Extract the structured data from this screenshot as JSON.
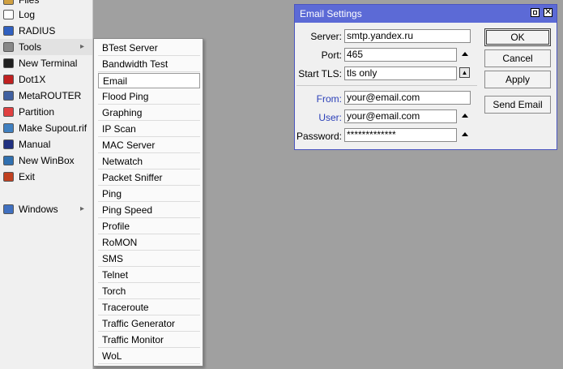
{
  "sidebar": {
    "items": [
      {
        "label": "Files",
        "icon": "folder-icon",
        "color": "#d0a040"
      },
      {
        "label": "Log",
        "icon": "log-icon",
        "color": "#ffffff"
      },
      {
        "label": "RADIUS",
        "icon": "users-icon",
        "color": "#3060c0"
      },
      {
        "label": "Tools",
        "icon": "tools-icon",
        "color": "#888888",
        "submenu": true
      },
      {
        "label": "New Terminal",
        "icon": "terminal-icon",
        "color": "#202020"
      },
      {
        "label": "Dot1X",
        "icon": "dot1x-icon",
        "color": "#c02020"
      },
      {
        "label": "MetaROUTER",
        "icon": "metarouter-icon",
        "color": "#4060a0"
      },
      {
        "label": "Partition",
        "icon": "partition-icon",
        "color": "#e04040"
      },
      {
        "label": "Make Supout.rif",
        "icon": "supout-icon",
        "color": "#4080c0"
      },
      {
        "label": "Manual",
        "icon": "manual-icon",
        "color": "#203080"
      },
      {
        "label": "New WinBox",
        "icon": "winbox-icon",
        "color": "#3070b0"
      },
      {
        "label": "Exit",
        "icon": "exit-icon",
        "color": "#c04020"
      },
      {
        "label": "Windows",
        "icon": "windows-icon",
        "color": "#4070c0",
        "submenu": true
      }
    ]
  },
  "submenu": {
    "items": [
      "BTest Server",
      "Bandwidth Test",
      "Email",
      "Flood Ping",
      "Graphing",
      "IP Scan",
      "MAC Server",
      "Netwatch",
      "Packet Sniffer",
      "Ping",
      "Ping Speed",
      "Profile",
      "RoMON",
      "SMS",
      "Telnet",
      "Torch",
      "Traceroute",
      "Traffic Generator",
      "Traffic Monitor",
      "WoL"
    ],
    "hovered": "Email"
  },
  "email_window": {
    "title": "Email Settings",
    "fields": {
      "server": {
        "label": "Server:",
        "value": "smtp.yandex.ru"
      },
      "port": {
        "label": "Port:",
        "value": "465"
      },
      "start_tls": {
        "label": "Start TLS:",
        "value": "tls only"
      },
      "from": {
        "label": "From:",
        "value": "your@email.com"
      },
      "user": {
        "label": "User:",
        "value": "your@email.com"
      },
      "password": {
        "label": "Password:",
        "value": "*************"
      }
    },
    "buttons": {
      "ok": "OK",
      "cancel": "Cancel",
      "apply": "Apply",
      "send_email": "Send Email"
    }
  }
}
